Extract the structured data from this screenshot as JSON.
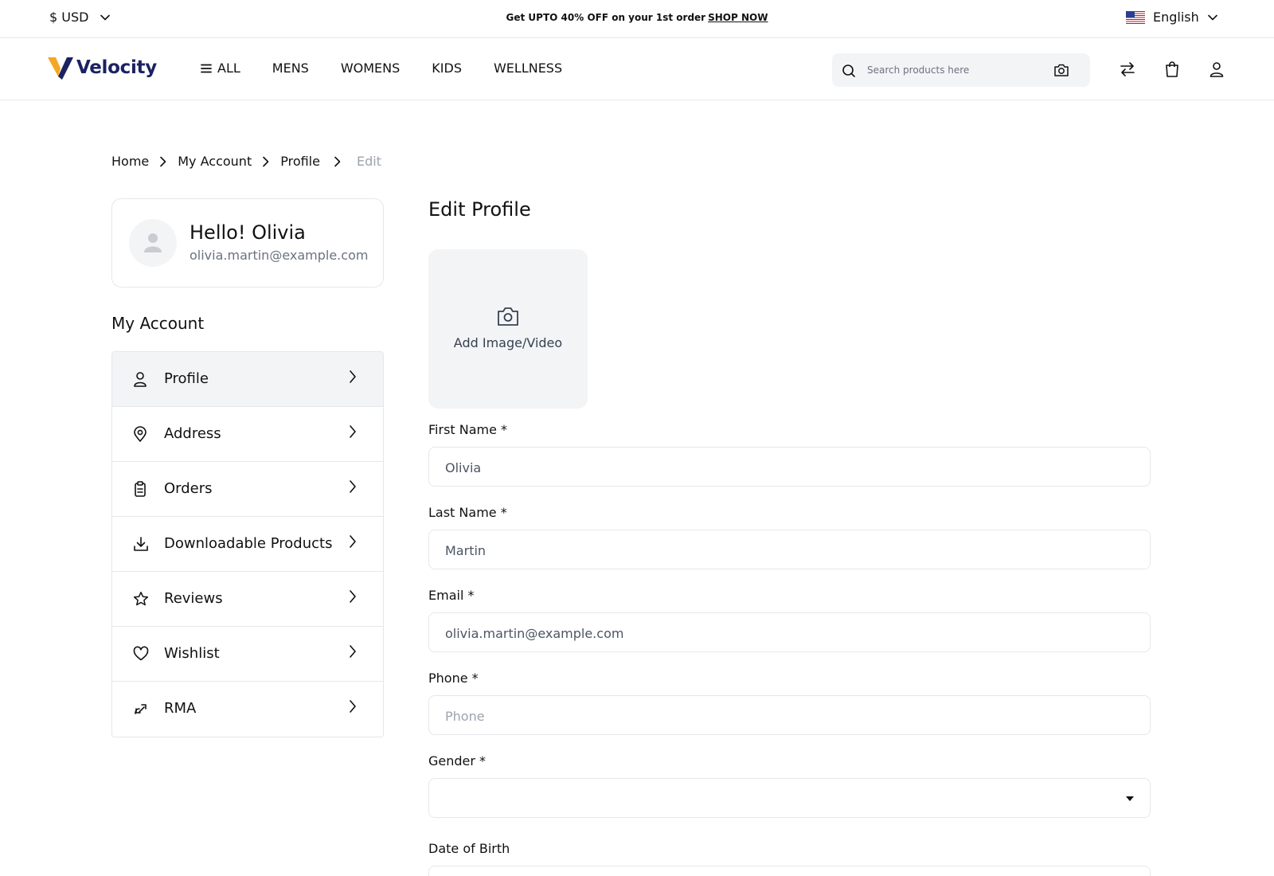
{
  "topbar": {
    "currency": "$ USD",
    "promo_text": "Get UPTO 40% OFF on your 1st order",
    "promo_link": "SHOP NOW",
    "language": "English"
  },
  "header": {
    "logo_text": "Velocity",
    "nav": {
      "all": "ALL",
      "mens": "MENS",
      "womens": "WOMENS",
      "kids": "KIDS",
      "wellness": "WELLNESS"
    },
    "search_placeholder": "Search products here"
  },
  "breadcrumb": {
    "home": "Home",
    "my_account": "My Account",
    "profile": "Profile",
    "current": "Edit"
  },
  "user": {
    "greeting": "Hello! Olivia",
    "email": "olivia.martin@example.com"
  },
  "account_menu": {
    "title": "My Account",
    "items": [
      {
        "label": "Profile"
      },
      {
        "label": "Address"
      },
      {
        "label": "Orders"
      },
      {
        "label": "Downloadable Products"
      },
      {
        "label": "Reviews"
      },
      {
        "label": "Wishlist"
      },
      {
        "label": "RMA"
      }
    ]
  },
  "form": {
    "title": "Edit Profile",
    "upload_label": "Add Image/Video",
    "first_name": {
      "label": "First Name *",
      "value": "Olivia"
    },
    "last_name": {
      "label": "Last Name *",
      "value": "Martin"
    },
    "email": {
      "label": "Email *",
      "value": "olivia.martin@example.com"
    },
    "phone": {
      "label": "Phone *",
      "value": "",
      "placeholder": "Phone"
    },
    "gender": {
      "label": "Gender *",
      "value": ""
    },
    "dob": {
      "label": "Date of Birth"
    }
  },
  "colors": {
    "brand_navy": "#1b2262",
    "logo_yellow": "#f5a623",
    "active_row_bg": "#f3f4f6",
    "border": "#e5e7eb"
  }
}
